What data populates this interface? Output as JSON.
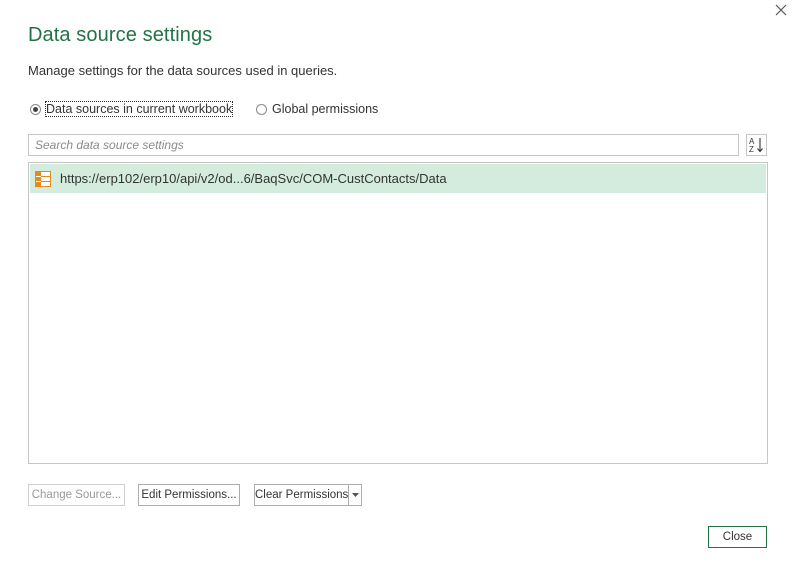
{
  "dialog": {
    "title": "Data source settings",
    "subtitle": "Manage settings for the data sources used in queries.",
    "close_icon": "close-icon"
  },
  "scope": {
    "options": [
      {
        "label": "Data sources in current workbook",
        "selected": true
      },
      {
        "label": "Global permissions",
        "selected": false
      }
    ]
  },
  "search": {
    "placeholder": "Search data source settings",
    "value": ""
  },
  "sort": {
    "icon": "sort-az-icon"
  },
  "sources": [
    {
      "icon": "table-icon",
      "url": "https://erp102/erp10/api/v2/od...6/BaqSvc/COM-CustContacts/Data",
      "selected": true
    }
  ],
  "buttons": {
    "change_source": "Change Source...",
    "edit_permissions": "Edit Permissions...",
    "clear_permissions": "Clear Permissions",
    "close": "Close"
  },
  "colors": {
    "accent": "#217346",
    "selection": "#d3ecdd",
    "icon_orange": "#e8891d"
  }
}
